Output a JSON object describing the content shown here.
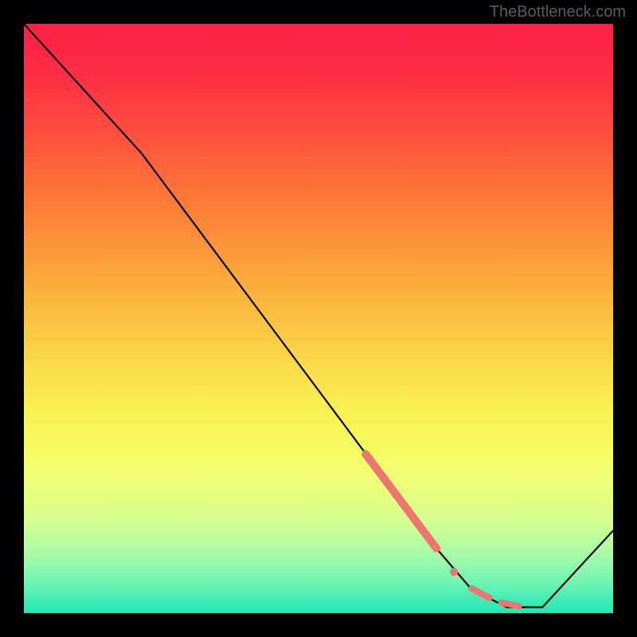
{
  "watermark": "TheBottleneck.com",
  "chart_data": {
    "type": "line",
    "title": "",
    "xlabel": "",
    "ylabel": "",
    "xlim": [
      0,
      100
    ],
    "ylim": [
      0,
      100
    ],
    "grid": false,
    "series": [
      {
        "name": "bottleneck-curve",
        "color": "#000000",
        "x": [
          0,
          20,
          70,
          76,
          82,
          88,
          100
        ],
        "y": [
          100,
          78,
          11,
          4,
          1,
          1,
          14
        ]
      }
    ],
    "highlight_segments": [
      {
        "name": "highlight-main",
        "color": "#eb7770",
        "x": [
          58,
          70
        ],
        "y": [
          27,
          11
        ],
        "width": 10
      },
      {
        "name": "highlight-dot-1",
        "color": "#eb7770",
        "cx": 73,
        "cy": 7,
        "r": 5
      },
      {
        "name": "highlight-dash-1",
        "color": "#eb7770",
        "x": [
          76,
          79
        ],
        "y": [
          4.2,
          2.6
        ],
        "width": 8
      },
      {
        "name": "highlight-dash-2",
        "color": "#eb7770",
        "x": [
          81,
          84
        ],
        "y": [
          1.8,
          1.2
        ],
        "width": 8
      }
    ],
    "gradient_stops": [
      {
        "pos": 0,
        "color": "#fd1f47"
      },
      {
        "pos": 50,
        "color": "#fbd245"
      },
      {
        "pos": 72,
        "color": "#f6fb61"
      },
      {
        "pos": 100,
        "color": "#23e8b7"
      }
    ]
  }
}
